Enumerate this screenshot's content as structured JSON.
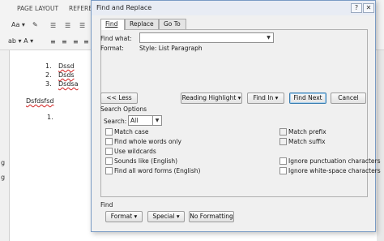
{
  "ribbon": {
    "tab_page_layout": "PAGE LAYOUT",
    "tab_references": "REFERE",
    "row1_icons": "Aa ▾",
    "row2_icons": "ab ▾ A ▾"
  },
  "document": {
    "list_items": [
      {
        "num": "1.",
        "text": "Dssd"
      },
      {
        "num": "2.",
        "text": "Dsds"
      },
      {
        "num": "3.",
        "text": "Dsdsa"
      }
    ],
    "paragraph": "Dsfdsfsd",
    "empty_num": "1.",
    "left_glyph_1": "g",
    "left_glyph_2": "g"
  },
  "dialog": {
    "title": "Find and Replace",
    "help": "?",
    "close": "✕",
    "tabs": {
      "find": "Find",
      "replace": "Replace",
      "goto": "Go To"
    },
    "find_what_label": "Find what:",
    "find_what_value": "",
    "format_label": "Format:",
    "format_value": "Style: List Paragraph",
    "less_button": "<< Less",
    "reading_highlight_button": "Reading Highlight ▾",
    "find_in_button": "Find In ▾",
    "find_next_button": "Find Next",
    "cancel_button": "Cancel",
    "search_options_title": "Search Options",
    "search_label": "Search:",
    "search_value": "All",
    "left_options": [
      "Match case",
      "Find whole words only",
      "Use wildcards",
      "Sounds like (English)",
      "Find all word forms (English)"
    ],
    "right_options": [
      "Match prefix",
      "Match suffix",
      "Ignore punctuation characters",
      "Ignore white-space characters"
    ],
    "find_section_title": "Find",
    "format_button": "Format ▾",
    "special_button": "Special ▾",
    "no_formatting_button": "No Formatting"
  },
  "colors": {
    "dialog_border": "#7a9bc4",
    "spell_underline": "#d02020",
    "primary_button_border": "#3c7fb1"
  }
}
